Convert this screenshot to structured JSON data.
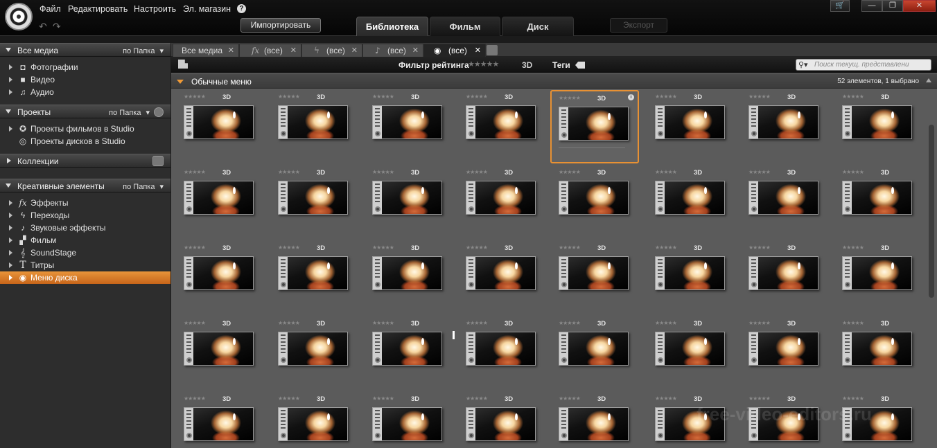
{
  "menu": {
    "items": [
      "Файл",
      "Редактировать",
      "Настроить",
      "Эл. магазин"
    ],
    "help_icon": "?"
  },
  "toolbar": {
    "import_label": "Импортировать",
    "export_label": "Экспорт",
    "main_tabs": [
      "Библиотека",
      "Фильм",
      "Диск"
    ],
    "active_tab": "Библиотека"
  },
  "window_controls": {
    "cart": "🛒",
    "minimize": "—",
    "maximize": "❐",
    "close": "✕"
  },
  "sidebar": {
    "all_media": {
      "title": "Все медиа",
      "sort": "по Папка"
    },
    "media_items": [
      {
        "label": "Фотографии",
        "icon": "camera-icon",
        "glyph": "◘"
      },
      {
        "label": "Видео",
        "icon": "video-camera-icon",
        "glyph": "■"
      },
      {
        "label": "Аудио",
        "icon": "music-note-icon",
        "glyph": "♫"
      }
    ],
    "projects": {
      "title": "Проекты",
      "sort": "по Папка"
    },
    "project_items": [
      {
        "label": "Проекты фильмов в Studio",
        "icon": "film-reel-icon",
        "glyph": "✪"
      },
      {
        "label": "Проекты дисков в Studio",
        "icon": "disc-icon",
        "glyph": "◎"
      }
    ],
    "collections": {
      "title": "Коллекции"
    },
    "creative": {
      "title": "Креативные элементы",
      "sort": "по Папка"
    },
    "creative_items": [
      {
        "label": "Эффекты",
        "icon": "fx-icon",
        "glyph": "fx"
      },
      {
        "label": "Переходы",
        "icon": "lightning-icon",
        "glyph": "ϟ"
      },
      {
        "label": "Звуковые эффекты",
        "icon": "note-icon",
        "glyph": "♪"
      },
      {
        "label": "Фильм",
        "icon": "film-icon",
        "glyph": "▞"
      },
      {
        "label": "SoundStage",
        "icon": "treble-clef-icon",
        "glyph": "𝄞"
      },
      {
        "label": "Титры",
        "icon": "title-t-icon",
        "glyph": "T"
      },
      {
        "label": "Меню диска",
        "icon": "disc-menu-icon",
        "glyph": "◉"
      }
    ],
    "active_item": "Меню диска"
  },
  "library": {
    "tabs": [
      {
        "label": "Все медиа",
        "icon": ""
      },
      {
        "label": "(все)",
        "icon": "fx"
      },
      {
        "label": "(все)",
        "icon": "ϟ"
      },
      {
        "label": "(все)",
        "icon": "♪"
      },
      {
        "label": "(все)",
        "icon": "◉"
      }
    ],
    "active_tab_index": 4,
    "filter": {
      "rating_label": "Фильтр рейтинга",
      "rating_stars": "★★★★★",
      "three_d": "3D",
      "tags_label": "Теги",
      "search_placeholder": "Поиск текущ. представлени"
    },
    "group": {
      "title": "Обычные меню",
      "count": "52 элементов, 1 выбрано"
    },
    "items": {
      "rating_stars": "★★★★★",
      "badge": "3D",
      "info_glyph": "i",
      "rows": 5,
      "columns": 8,
      "selected_index": 4
    }
  },
  "watermark": "free-video-editors.ru"
}
